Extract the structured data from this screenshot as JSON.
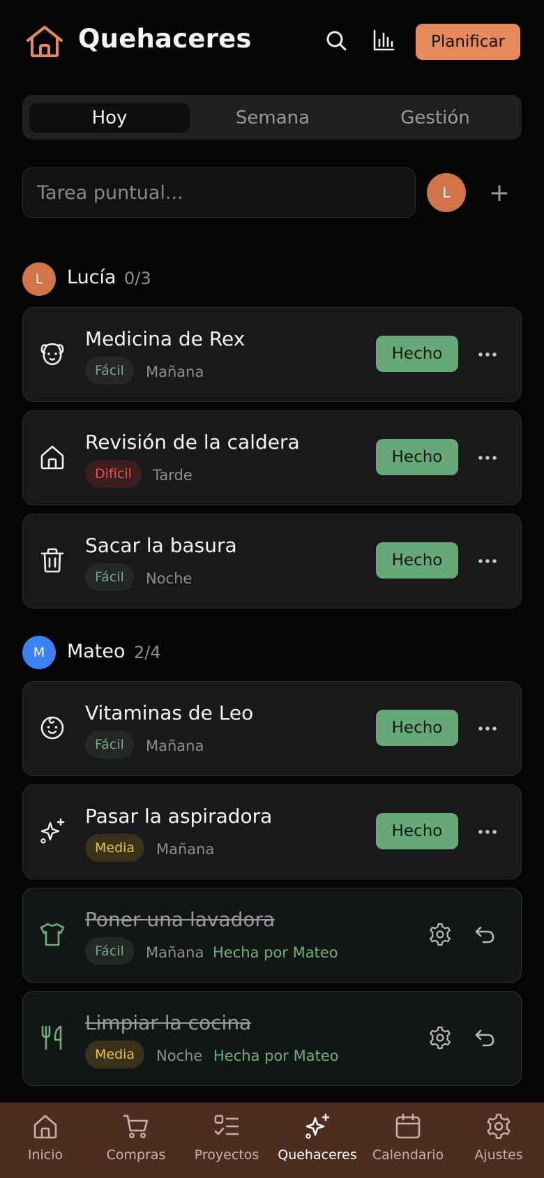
{
  "header": {
    "title": "Quehaceres",
    "logo_icon": "house-icon",
    "search_icon": "search-icon",
    "stats_icon": "bar-chart-icon",
    "plan_label": "Planificar"
  },
  "tabs": [
    {
      "label": "Hoy",
      "active": true
    },
    {
      "label": "Semana",
      "active": false
    },
    {
      "label": "Gestión",
      "active": false
    }
  ],
  "quick_add": {
    "placeholder": "Tarea puntual...",
    "value": "",
    "assignee_initial": "L",
    "add_symbol": "+"
  },
  "groups": [
    {
      "initial": "L",
      "name": "Lucía",
      "count": "0/3",
      "color": "#d2744a",
      "tasks": [
        {
          "title": "Medicina de Rex",
          "icon": "dog-icon",
          "difficulty": "Fácil",
          "time": "Mañana",
          "done": false,
          "action": "Hecho"
        },
        {
          "title": "Revisión de la caldera",
          "icon": "house-icon",
          "difficulty": "Difícil",
          "time": "Tarde",
          "done": false,
          "action": "Hecho"
        },
        {
          "title": "Sacar la basura",
          "icon": "trash-icon",
          "difficulty": "Fácil",
          "time": "Noche",
          "done": false,
          "action": "Hecho"
        }
      ]
    },
    {
      "initial": "M",
      "name": "Mateo",
      "count": "2/4",
      "color": "#3b82f6",
      "tasks": [
        {
          "title": "Vitaminas de Leo",
          "icon": "baby-icon",
          "difficulty": "Fácil",
          "time": "Mañana",
          "done": false,
          "action": "Hecho"
        },
        {
          "title": "Pasar la aspiradora",
          "icon": "sparkles-icon",
          "difficulty": "Media",
          "time": "Mañana",
          "done": false,
          "action": "Hecho"
        },
        {
          "title": "Poner una lavadora",
          "icon": "shirt-icon",
          "difficulty": "Fácil",
          "time": "Mañana",
          "done": true,
          "done_by": "Hecha por Mateo"
        },
        {
          "title": "Limpiar la cocina",
          "icon": "utensils-icon",
          "difficulty": "Media",
          "time": "Noche",
          "done": true,
          "done_by": "Hecha por Mateo"
        }
      ]
    }
  ],
  "nav": [
    {
      "label": "Inicio",
      "icon": "home-icon",
      "active": false
    },
    {
      "label": "Compras",
      "icon": "cart-icon",
      "active": false
    },
    {
      "label": "Proyectos",
      "icon": "checklist-icon",
      "active": false
    },
    {
      "label": "Quehaceres",
      "icon": "sparkles-icon",
      "active": true
    },
    {
      "label": "Calendario",
      "icon": "calendar-icon",
      "active": false
    },
    {
      "label": "Ajustes",
      "icon": "gear-icon",
      "active": false
    }
  ],
  "colors": {
    "accent": "#e58a5c",
    "done_button": "#67a878",
    "bottom_nav": "#4d2d1f",
    "background": "#050505"
  }
}
